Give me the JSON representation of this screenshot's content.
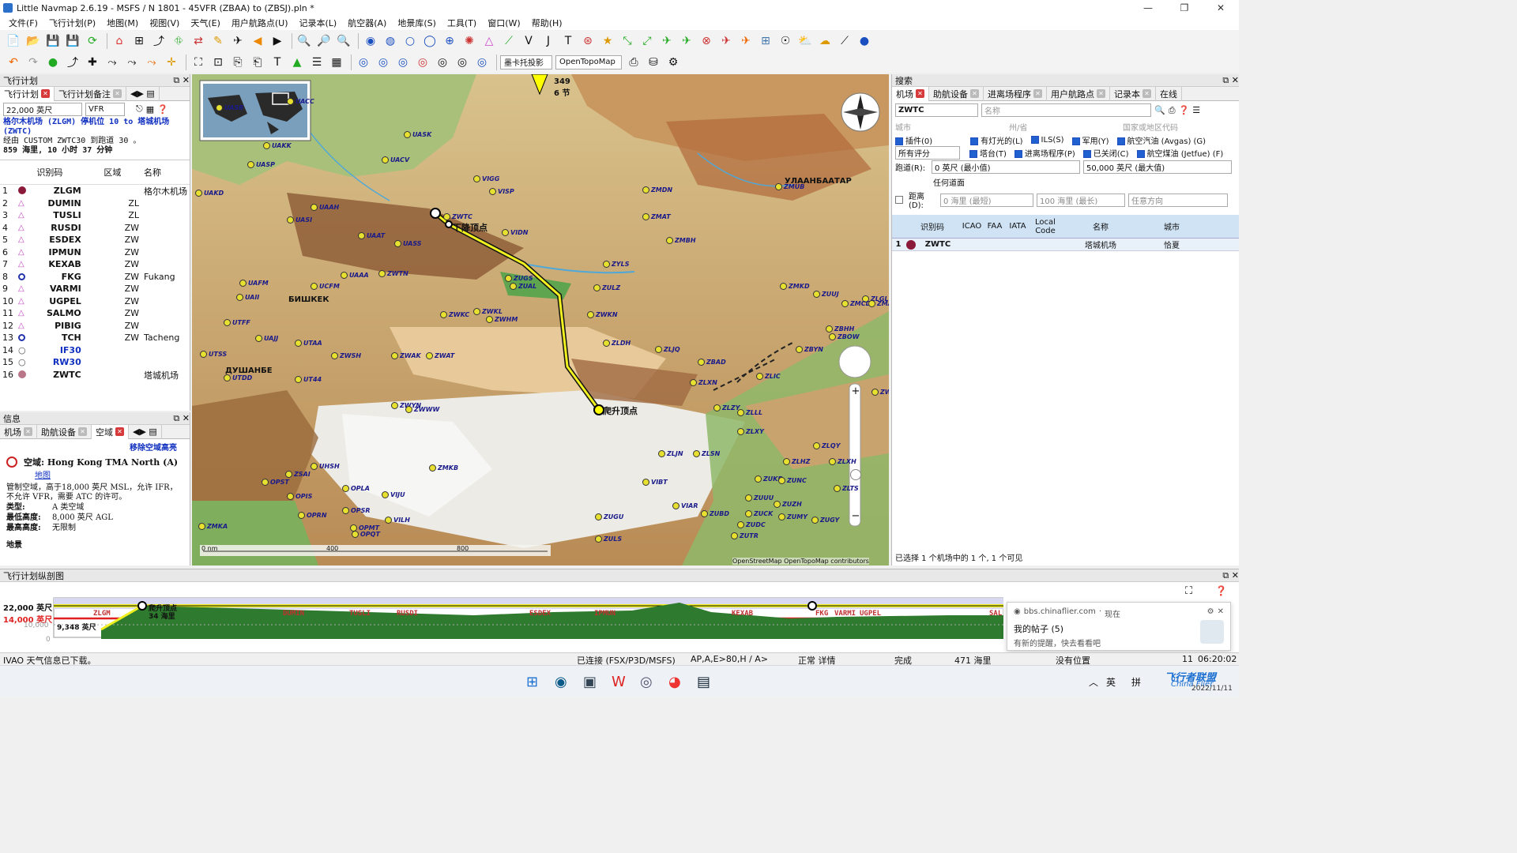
{
  "window": {
    "title": "Little Navmap 2.6.19 - MSFS / N 1801 - 45VFR  (ZBAA) to  (ZBSJ).pln *"
  },
  "menu": [
    "文件(F)",
    "飞行计划(P)",
    "地图(M)",
    "视图(V)",
    "天气(E)",
    "用户航路点(U)",
    "记录本(L)",
    "航空器(A)",
    "地景库(S)",
    "工具(T)",
    "窗口(W)",
    "帮助(H)"
  ],
  "toolbar2": {
    "projection": "墨卡托投影",
    "theme": "OpenTopoMap"
  },
  "flightplan_panel": {
    "title": "飞行计划",
    "tabs": [
      "飞行计划",
      "飞行计划备注"
    ],
    "cruise_alt": "22,000 英尺",
    "rules": "VFR",
    "header_line1": "格尔木机场 (ZLGM) 停机位 10 to 塔城机场 (ZWTC)",
    "header_line2": "经由 CUSTOM ZWTC30 到跑道 30 。",
    "header_line3": "859 海里, 10 小时 37 分钟",
    "columns": [
      "识别码",
      "区域",
      "名称"
    ],
    "rows": [
      {
        "n": "1",
        "type": "apt",
        "id": "ZLGM",
        "region": "",
        "name": "格尔木机场"
      },
      {
        "n": "2",
        "type": "wp",
        "id": "DUMIN",
        "region": "ZL",
        "name": ""
      },
      {
        "n": "3",
        "type": "wp",
        "id": "TUSLI",
        "region": "ZL",
        "name": ""
      },
      {
        "n": "4",
        "type": "wp",
        "id": "RUSDI",
        "region": "ZW",
        "name": ""
      },
      {
        "n": "5",
        "type": "wp",
        "id": "ESDEX",
        "region": "ZW",
        "name": ""
      },
      {
        "n": "6",
        "type": "wp",
        "id": "IPMUN",
        "region": "ZW",
        "name": ""
      },
      {
        "n": "7",
        "type": "wp",
        "id": "KEXAB",
        "region": "ZW",
        "name": ""
      },
      {
        "n": "8",
        "type": "ndb",
        "id": "FKG",
        "region": "ZW",
        "name": "Fukang"
      },
      {
        "n": "9",
        "type": "wp",
        "id": "VARMI",
        "region": "ZW",
        "name": ""
      },
      {
        "n": "10",
        "type": "wp",
        "id": "UGPEL",
        "region": "ZW",
        "name": ""
      },
      {
        "n": "11",
        "type": "wp",
        "id": "SALMO",
        "region": "ZW",
        "name": ""
      },
      {
        "n": "12",
        "type": "wp",
        "id": "PIBIG",
        "region": "ZW",
        "name": ""
      },
      {
        "n": "13",
        "type": "ndb",
        "id": "TCH",
        "region": "ZW",
        "name": "Tacheng"
      },
      {
        "n": "14",
        "type": "proc",
        "id": "IF30",
        "region": "",
        "name": ""
      },
      {
        "n": "15",
        "type": "proc",
        "id": "RW30",
        "region": "",
        "name": ""
      },
      {
        "n": "16",
        "type": "dest",
        "id": "ZWTC",
        "region": "",
        "name": "塔城机场"
      }
    ]
  },
  "info_panel": {
    "title": "信息",
    "tabs": [
      "机场",
      "助航设备",
      "空域"
    ],
    "remove_highlight": "移除空域高亮",
    "airspace_title": "空域: Hong Kong TMA North (A)",
    "map_link": "地图",
    "desc": "管制空域，高于18,000 英尺 MSL，允许 IFR，不允许 VFR，需要 ATC 的许可。",
    "type_label": "类型:",
    "type_value": "A 类空域",
    "min_label": "最低高度:",
    "min_value": "8,000 英尺 AGL",
    "max_label": "最高高度:",
    "max_value": "无限制",
    "footer_label": "地景"
  },
  "map": {
    "top_label_a": "349",
    "top_label_b": "6 节",
    "tod_label": "下降顶点",
    "toc_label": "爬升顶点",
    "ulaan": "УЛААНБААТАР",
    "bishkek": "БИШКЕК",
    "dushanbe": "ДУШАНБЕ",
    "scale_0": "0 nm",
    "scale_1": "400",
    "scale_2": "800",
    "attribution": "OpenStreetMap  OpenTopoMap contributors",
    "zoom_plus": "+",
    "zoom_minus": "−",
    "airports": [
      "UASP",
      "UASB",
      "UAKK",
      "UAKD",
      "UACC",
      "UASK",
      "UACV",
      "UAAH",
      "UASI",
      "UAAT",
      "UASS",
      "UAII",
      "UAFM",
      "UCFM",
      "UAAA",
      "UTFF",
      "UTSS",
      "UTDD",
      "UT44",
      "UTAA",
      "UAJJ",
      "ZWTC",
      "ZWYN",
      "ZWWW",
      "ZWSH",
      "ZWAK",
      "ZWKL",
      "ZWHM",
      "ZWKC",
      "ZWAT",
      "ZWTN",
      "ZLDH",
      "ZLJQ",
      "ZBAD",
      "ZLXN",
      "ZLZY",
      "ZLLL",
      "ZLXY",
      "ZLIC",
      "ZBYN",
      "ZBHH",
      "ZBOW",
      "ZMUB",
      "ZMDN",
      "ZMAT",
      "ZMBH",
      "ZMKD",
      "ZMKB",
      "ZUGU",
      "ZULS",
      "ZUBD",
      "ZUDC",
      "ZUKD",
      "ZUUU",
      "ZUZH",
      "ZUCK",
      "ZUTR",
      "ZUMY",
      "ZUGY",
      "ZUNC",
      "ZLHZ",
      "ZLQY",
      "ZLXH",
      "ZLTS",
      "ZLJN",
      "ZLSN",
      "ZLGL",
      "ZUUJ",
      "ZMCD",
      "ZMAH",
      "ZMKA",
      "UHSH",
      "ZSAI",
      "OPST",
      "OPIS",
      "OPRN",
      "OPLA",
      "OPSR",
      "OPMT",
      "OPQT",
      "VIJU",
      "VILH",
      "VIAR",
      "VIBT",
      "VIGG",
      "VISP",
      "VIDN",
      "ZUGS",
      "ZUAL",
      "ZULZ",
      "ZYLS",
      "ZWKN",
      "ZWFY",
      "ZWAY",
      "ZWSS",
      "ZWCM",
      "ZWNL",
      "ZWRQ",
      "ZLJL",
      "ZBEH"
    ]
  },
  "search_panel": {
    "title": "搜索",
    "tabs": [
      "机场",
      "助航设备",
      "进离场程序",
      "用户航路点",
      "记录本",
      "在线"
    ],
    "query": "ZWTC",
    "name_ph": "名称",
    "city_ph": "城市",
    "state_ph": "州/省",
    "country_ph": "国家或地区代码",
    "filters": [
      {
        "label": "插件(0)",
        "on": true
      },
      {
        "label": "有灯光的(L)",
        "on": true
      },
      {
        "label": "ILS(S)",
        "on": true
      },
      {
        "label": "军用(Y)",
        "on": true
      },
      {
        "label": "航空汽油 (Avgas) (G)",
        "on": true
      }
    ],
    "filters2": [
      {
        "label": "塔台(T)",
        "on": true
      },
      {
        "label": "进离场程序(P)",
        "on": true
      },
      {
        "label": "已关闭(C)",
        "on": true
      },
      {
        "label": "航空煤油 (Jetfue) (F)",
        "on": true
      }
    ],
    "rating": "所有评分",
    "runway_label": "跑道(R):",
    "rw_min": "0 英尺 (最小值)",
    "rw_max": "50,000 英尺 (最大值)",
    "surface": "任何道面",
    "dist_label": "距离(D):",
    "dist_min": "0 海里 (最短)",
    "dist_max": "100 海里 (最长)",
    "direction": "任意方向",
    "columns": [
      "识别码",
      "ICAO",
      "FAA",
      "IATA",
      "Local Code",
      "名称",
      "城市"
    ],
    "row": {
      "n": "1",
      "id": "ZWTC",
      "name": "塔城机场",
      "city": "恰夏"
    },
    "status": "已选择 1 个机场中的 1 个, 1 个可见"
  },
  "profile": {
    "title": "飞行计划纵剖图",
    "alt1": "22,000 英尺",
    "alt2": "14,000 英尺",
    "alt3": "10,000",
    "alt4": "0",
    "alt_cur": "9,348 英尺",
    "toc": "爬升顶点",
    "toc_dist": "34 海里",
    "waypoints": [
      "ZLGM",
      "DUMIN",
      "TUSLI",
      "RUSDI",
      "ESDEX",
      "IPMUN",
      "KEXAB",
      "FKG",
      "VARMI",
      "UGPEL",
      "SAL"
    ]
  },
  "notification": {
    "site": "bbs.chinaflier.com",
    "time": "现在",
    "title": "我的帖子 (5)",
    "body": "有新的提醒，快去看看吧"
  },
  "status": {
    "left": "IVAO 天气信息已下载。",
    "conn": "已连接 (FSX/P3D/MSFS)",
    "ap": "AP,A,E>80,H / A>",
    "detail": "正常 详情",
    "done": "完成",
    "dist": "471 海里",
    "pos": "没有位置",
    "time": "06:20:02 Z",
    "day": "11"
  },
  "taskbar": {
    "ime1": "英",
    "ime2": "拼",
    "date": "2022/11/11",
    "watermark": "飞行者联盟",
    "watermark2": "China Flier"
  }
}
